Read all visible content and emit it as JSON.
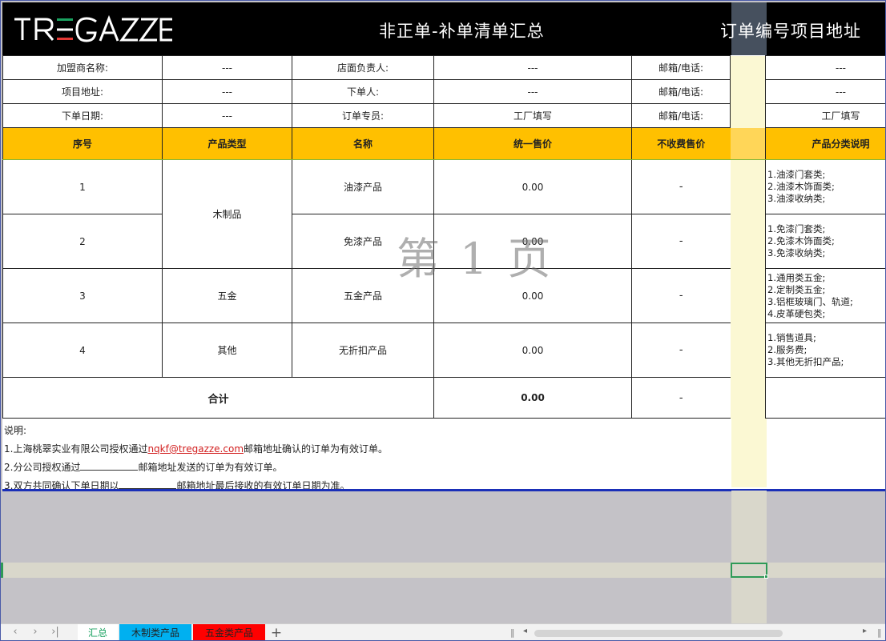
{
  "header": {
    "logo_text": "TRE GAZZE",
    "title": "非正单-补单清单汇总",
    "order_title": "订单编号项目地址"
  },
  "info_rows": [
    {
      "l1": "加盟商名称:",
      "v1": "---",
      "l2": "店面负责人:",
      "v2": "---",
      "l3": "邮箱/电话:",
      "v3": "---"
    },
    {
      "l1": "项目地址:",
      "v1": "---",
      "l2": "下单人:",
      "v2": "---",
      "l3": "邮箱/电话:",
      "v3": "---"
    },
    {
      "l1": "下单日期:",
      "v1": "---",
      "l2": "订单专员:",
      "v2": "工厂填写",
      "l3": "邮箱/电话:",
      "v3": "工厂填写"
    }
  ],
  "columns": {
    "seq": "序号",
    "type": "产品类型",
    "name": "名称",
    "price": "统一售价",
    "free_price": "不收费售价",
    "category": "产品分类说明"
  },
  "rows": [
    {
      "seq": "1",
      "name": "油漆产品",
      "price": "0.00",
      "free": "-",
      "cats": [
        "1.油漆门套类;",
        "2.油漆木饰面类;",
        "3.油漆收纳类;"
      ]
    },
    {
      "seq": "2",
      "name": "免漆产品",
      "price": "0.00",
      "free": "-",
      "cats": [
        "1.免漆门套类;",
        "2.免漆木饰面类;",
        "3.免漆收纳类;"
      ]
    },
    {
      "seq": "3",
      "type": "五金",
      "name": "五金产品",
      "price": "0.00",
      "free": "-",
      "cats": [
        "1.通用类五金;",
        "2.定制类五金;",
        "3.铝框玻璃门、轨道;",
        "4.皮革硬包类;"
      ]
    },
    {
      "seq": "4",
      "type": "其他",
      "name": "无折扣产品",
      "price": "0.00",
      "free": "-",
      "cats": [
        "1.销售道具;",
        "2.服务费;",
        "3.其他无折扣产品;"
      ]
    }
  ],
  "wood_type": "木制品",
  "total": {
    "label": "合计",
    "price": "0.00",
    "free": "-"
  },
  "notes": {
    "heading": "说明:",
    "line1_pre": "1.上海桃翠实业有限公司授权通过",
    "line1_email": "nqkf@tregazze.com",
    "line1_post": "邮箱地址确认的订单为有效订单。",
    "line2_pre": "2.分公司授权通过",
    "line2_post": "邮箱地址发送的订单为有效订单。",
    "line3_pre": "3.双方共同确认下单日期以",
    "line3_post": "邮箱地址最后接收的有效订单日期为准。"
  },
  "watermark": "第 1 页",
  "tabs": [
    {
      "label": "汇总"
    },
    {
      "label": "木制类产品"
    },
    {
      "label": "五金类产品"
    }
  ],
  "colors": {
    "header_bg": "#000000",
    "table_head": "#ffc000",
    "wood_tab": "#00b0f0",
    "hardware_tab": "#ff0000",
    "active_tab_text": "#1aa260"
  }
}
